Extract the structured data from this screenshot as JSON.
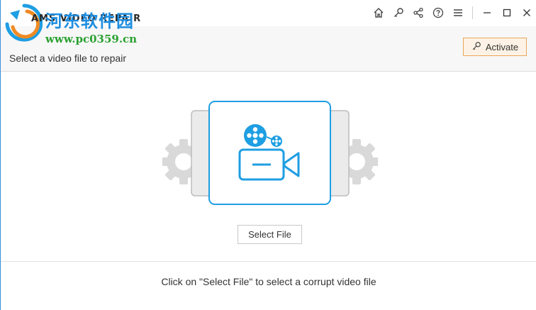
{
  "app": {
    "title": "AMS VIDEO REPAIR",
    "watermark_line1": "河东软件园",
    "watermark_line2": "www.pc0359.cn"
  },
  "toolbar": {
    "icons": [
      "home-icon",
      "key-icon",
      "share-icon",
      "help-icon",
      "menu-icon",
      "minimize-icon",
      "maximize-icon",
      "close-icon"
    ]
  },
  "header": {
    "instruction": "Select a video file to repair",
    "activate_label": "Activate"
  },
  "main": {
    "select_file_label": "Select File",
    "hint": "Click on \"Select File\" to select a corrupt video file"
  },
  "colors": {
    "accent": "#1e9ee3",
    "activate_border": "#e9a75a",
    "activate_bg": "#fdf2e5",
    "gear": "#d9d9d9"
  }
}
